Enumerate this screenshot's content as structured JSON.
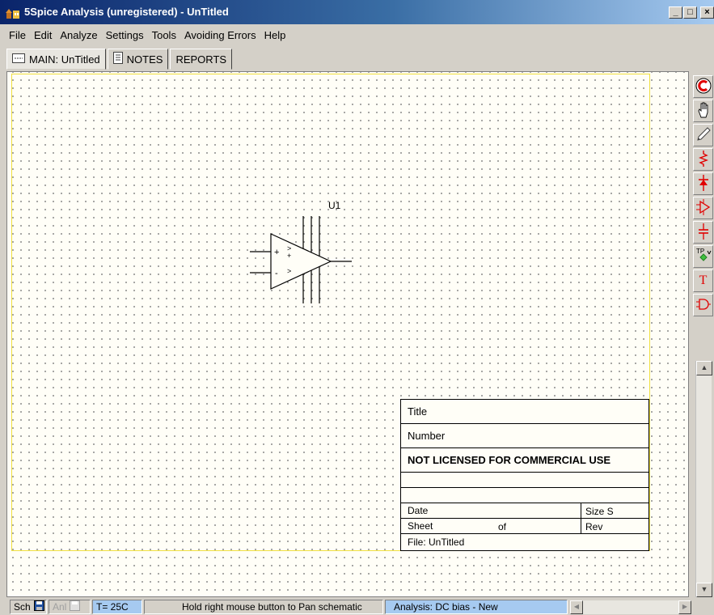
{
  "window": {
    "title": "5Spice Analysis (unregistered) - UnTitled"
  },
  "menu": [
    "File",
    "Edit",
    "Analyze",
    "Settings",
    "Tools",
    "Avoiding Errors",
    "Help"
  ],
  "tabs": [
    {
      "label": "MAIN: UnTitled",
      "icon": "schematic-icon",
      "active": true
    },
    {
      "label": "NOTES",
      "icon": "notes-icon",
      "active": false
    },
    {
      "label": "REPORTS",
      "icon": "",
      "active": false
    }
  ],
  "schematic": {
    "component_label": "U1",
    "plus_sign": "+",
    "minus_sign": "-",
    "pin_marks": [
      ">",
      "+",
      ">"
    ]
  },
  "title_block": {
    "title_label": "Title",
    "number_label": "Number",
    "license_notice": "NOT LICENSED FOR COMMERCIAL USE",
    "date_label": "Date",
    "size_label": "Size  S",
    "sheet_label": "Sheet",
    "of_label": "of",
    "rev_label": "Rev",
    "file_label": "File:  UnTitled"
  },
  "toolbar": {
    "tools": [
      "redo-c-icon",
      "hand-pan-icon",
      "pencil-icon",
      "resistor-icon",
      "diode-icon",
      "opamp-icon",
      "capacitor-icon",
      "testpoint-icon",
      "text-icon",
      "logic-gate-icon"
    ],
    "text_tool": "T",
    "testpoint_label": "TP"
  },
  "status": {
    "sch_label": "Sch",
    "anl_label": "Anl",
    "temperature": "T= 25C",
    "hint": "Hold right mouse button to Pan schematic",
    "analysis": "Analysis:  DC bias - New"
  },
  "colors": {
    "titlebar_start": "#0a246a",
    "titlebar_end": "#a6caf0",
    "status_highlight": "#a6caf0",
    "tool_red": "#e00000",
    "page_border": "#f0e040"
  }
}
